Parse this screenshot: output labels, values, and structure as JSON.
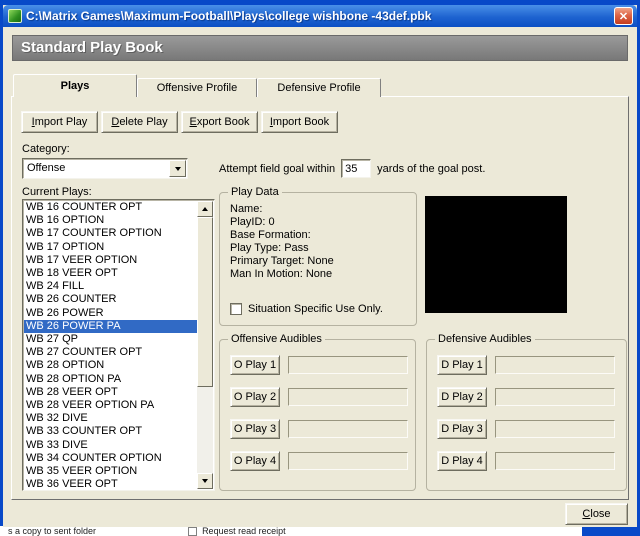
{
  "colors": {
    "titlebar_blue": "#0B4FC4",
    "desktop_blue": "#0849C8",
    "window_bg": "#ECE9D8",
    "header_gray": "#808080",
    "selection_blue": "#316AC5",
    "close_red": "#C33C1E",
    "preview_bg": "#000000"
  },
  "window": {
    "title": "C:\\Matrix Games\\Maximum-Football\\Plays\\college wishbone -43def.pbk",
    "close_glyph": "✕"
  },
  "header": {
    "title": "Standard Play Book"
  },
  "tabs": [
    "Plays",
    "Offensive Profile",
    "Defensive Profile"
  ],
  "toolbar": {
    "buttons": [
      "Import Play",
      "Delete Play",
      "Export Book",
      "Import Book"
    ]
  },
  "category": {
    "label": "Category:",
    "value": "Offense"
  },
  "field_goal": {
    "text_before": "Attempt field goal within",
    "value": "35",
    "text_after": "yards of the goal post."
  },
  "plays": {
    "label": "Current Plays:",
    "selected": "WB 26 POWER PA",
    "items": [
      "WB 16 COUNTER OPT",
      "WB 16 OPTION",
      "WB 17 COUNTER OPTION",
      "WB 17 OPTION",
      "WB 17 VEER OPTION",
      "WB 18 VEER OPT",
      "WB 24 FILL",
      "WB 26 COUNTER",
      "WB 26 POWER",
      "WB 26 POWER PA",
      "WB 27 QP",
      "WB 27 COUNTER OPT",
      "WB 28 OPTION",
      "WB 28 OPTION PA",
      "WB 28 VEER OPT",
      "WB 28 VEER OPTION PA",
      "WB 32 DIVE",
      "WB 33 COUNTER OPT",
      "WB 33 DIVE",
      "WB 34 COUNTER OPTION",
      "WB 35 VEER OPTION",
      "WB 36 VEER OPT"
    ]
  },
  "play_data": {
    "title": "Play Data",
    "fields": [
      "Name:",
      "PlayID: 0",
      "Base Formation:",
      "Play Type: Pass",
      "Primary Target: None",
      "Man In Motion: None"
    ],
    "checkbox_label": "Situation Specific Use Only.",
    "checked": false
  },
  "audibles": {
    "offensive_title": "Offensive Audibles",
    "defensive_title": "Defensive Audibles",
    "offensive": [
      "O Play 1",
      "O Play 2",
      "O Play 3",
      "O Play 4"
    ],
    "defensive": [
      "D Play 1",
      "D Play 2",
      "D Play 3",
      "D Play 4"
    ]
  },
  "close_button": {
    "label": "Close"
  },
  "background_window": {
    "left_text": "s a copy to sent folder",
    "right_text": "Request read receipt"
  }
}
